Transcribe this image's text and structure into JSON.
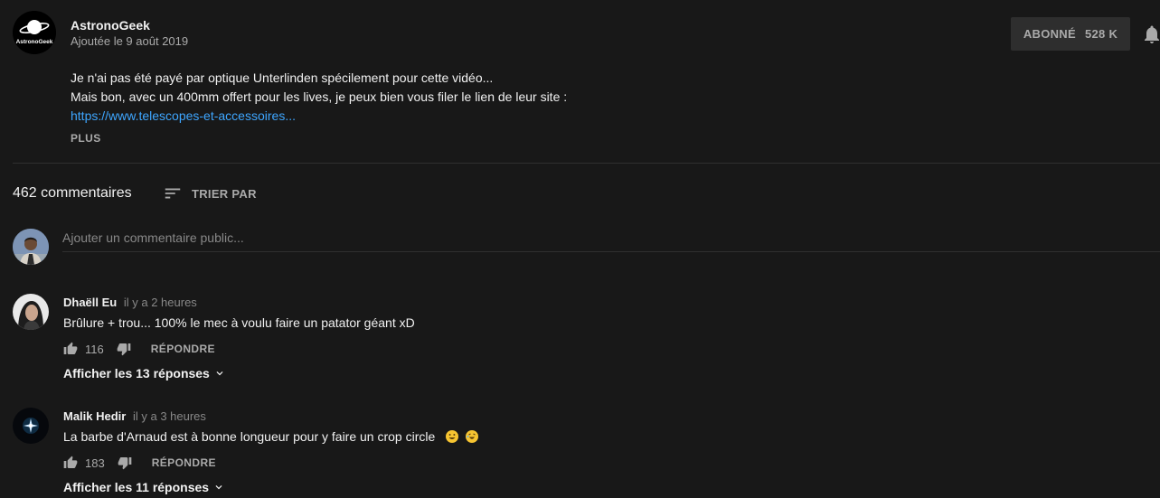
{
  "channel": {
    "name": "AstronoGeek",
    "published": "Ajoutée le 9 août 2019",
    "logo_text": "AstronoGeek",
    "subscribe_label": "ABONNÉ",
    "subscriber_count": "528 K"
  },
  "description": {
    "line1": "Je n'ai pas été payé par optique Unterlinden spécilement pour cette vidéo...",
    "line2": "Mais bon, avec un 400mm offert pour les lives, je peux bien vous filer le lien de leur site :",
    "link": "https://www.telescopes-et-accessoires...",
    "more_label": "PLUS"
  },
  "comments_header": {
    "count_label": "462 commentaires",
    "sort_label": "TRIER PAR"
  },
  "add_comment": {
    "placeholder": "Ajouter un commentaire public..."
  },
  "comments": [
    {
      "author": "Dhaëll Eu",
      "time": "il y a 2 heures",
      "text": "Brûlure + trou... 100% le mec à voulu faire un patator géant xD",
      "likes": "116",
      "reply_label": "RÉPONDRE",
      "replies_label": "Afficher les 13 réponses"
    },
    {
      "author": "Malik Hedir",
      "time": "il y a 3 heures",
      "text": "La barbe d'Arnaud est à bonne longueur pour y faire un crop circle",
      "likes": "183",
      "reply_label": "RÉPONDRE",
      "replies_label": "Afficher les 11 réponses"
    }
  ],
  "colors": {
    "background": "#181818",
    "link": "#3ea6ff",
    "secondary_text": "#aaaaaa",
    "subscribe_bg": "#2e2e2e"
  },
  "icons": {
    "bell": "bell-icon",
    "sort": "sort-icon",
    "like": "thumb-up-icon",
    "dislike": "thumb-down-icon",
    "expand": "chevron-down-icon"
  }
}
